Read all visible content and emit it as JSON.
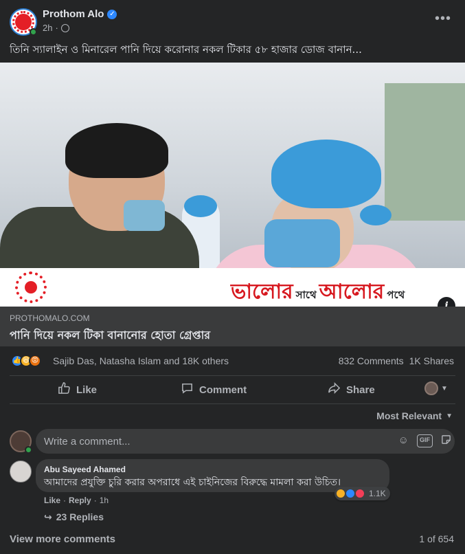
{
  "post": {
    "page_name": "Prothom Alo",
    "time": "2h",
    "separator": "·",
    "caption": "তিনি স্যালাইন ও মিনারেল পানি দিয়ে করোনার নকল টিকার ৫৮ হাজার ডোজ বানান..."
  },
  "banner": {
    "slogan_word1": "ভালোর",
    "slogan_small1": "সাথে",
    "slogan_word2": "আলোর",
    "slogan_small2": "পথে"
  },
  "link": {
    "domain": "PROTHOMALO.COM",
    "title": "পানি দিয়ে নকল টিকা বানানোর হোতা গ্রেপ্তার"
  },
  "stats": {
    "reactors": "Sajib Das, Natasha Islam and 18K others",
    "comments": "832 Comments",
    "shares": "1K Shares"
  },
  "actions": {
    "like": "Like",
    "comment": "Comment",
    "share": "Share"
  },
  "comments_section": {
    "sort_label": "Most Relevant",
    "input_placeholder": "Write a comment...",
    "gif_label": "GIF",
    "view_more": "View more comments",
    "pager": "1 of 654"
  },
  "comment": {
    "author": "Abu Sayeed Ahamed",
    "text": "আমাদের প্রযুক্তি চুরি করার অপরাধে এই চাইনিজের বিরুদ্ধে মামলা করা উচিত।",
    "reaction_count": "1.1K",
    "like_label": "Like",
    "reply_label": "Reply",
    "time": "1h",
    "replies": "23 Replies"
  },
  "colors": {
    "background": "#242526",
    "surface": "#3a3b3c",
    "primary_text": "#e4e6eb",
    "secondary_text": "#b0b3b8",
    "brand_red": "#e41f26",
    "facebook_blue": "#2d88ff"
  },
  "icons": {
    "verified": "verified-badge-icon",
    "globe": "globe-icon",
    "more": "more-options-icon",
    "like": "thumbs-up-icon",
    "comment": "speech-bubble-icon",
    "share": "share-arrow-icon",
    "emoji": "smiley-icon",
    "sticker": "sticker-icon",
    "reply_arrow": "reply-arrow-icon",
    "info": "info-icon"
  }
}
